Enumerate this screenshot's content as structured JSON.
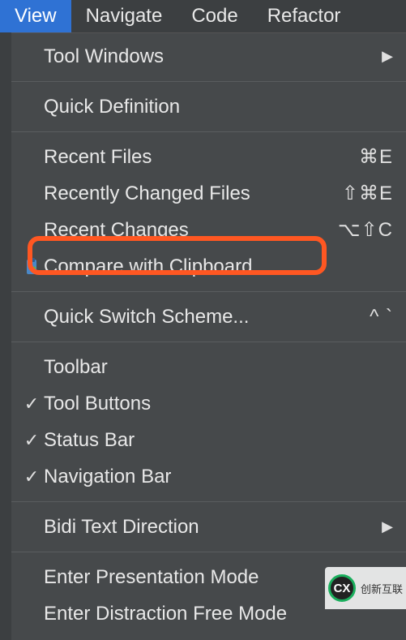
{
  "menubar": {
    "items": [
      {
        "label": "View",
        "active": true
      },
      {
        "label": "Navigate",
        "active": false
      },
      {
        "label": "Code",
        "active": false
      },
      {
        "label": "Refactor",
        "active": false
      }
    ]
  },
  "dropdown": {
    "groups": [
      [
        {
          "label": "Tool Windows",
          "submenu": true
        }
      ],
      [
        {
          "label": "Quick Definition"
        }
      ],
      [
        {
          "label": "Recent Files",
          "shortcut": "⌘E"
        },
        {
          "label": "Recently Changed Files",
          "shortcut": "⇧⌘E"
        },
        {
          "label": "Recent Changes",
          "shortcut": "⌥⇧C",
          "highlighted": true
        },
        {
          "label": "Compare with Clipboard",
          "icon": "compare-clipboard"
        }
      ],
      [
        {
          "label": "Quick Switch Scheme...",
          "shortcut": "^ `"
        }
      ],
      [
        {
          "label": "Toolbar"
        },
        {
          "label": "Tool Buttons",
          "checked": true
        },
        {
          "label": "Status Bar",
          "checked": true
        },
        {
          "label": "Navigation Bar",
          "checked": true
        }
      ],
      [
        {
          "label": "Bidi Text Direction",
          "submenu": true
        }
      ],
      [
        {
          "label": "Enter Presentation Mode"
        },
        {
          "label": "Enter Distraction Free Mode"
        }
      ]
    ]
  },
  "watermark": {
    "text": "创新互联"
  }
}
